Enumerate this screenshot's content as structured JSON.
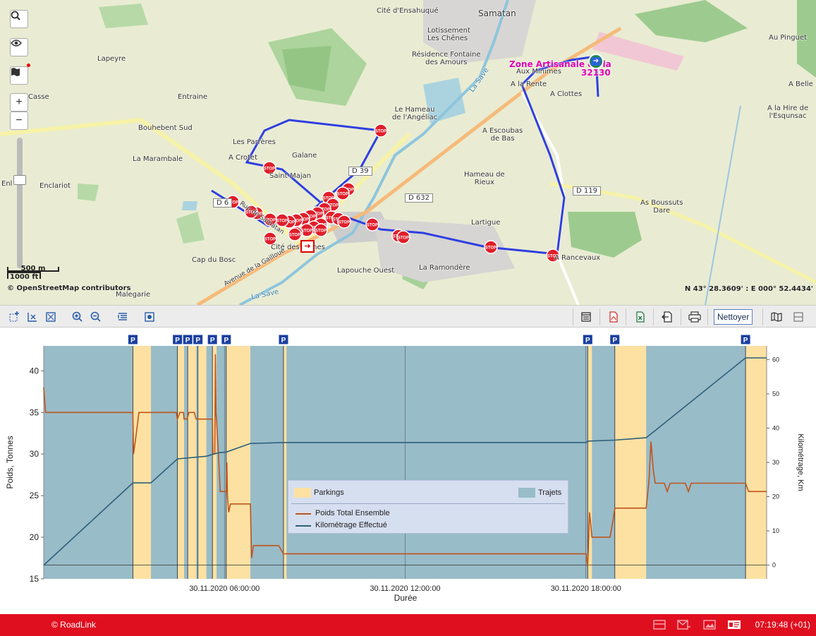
{
  "map": {
    "places": [
      {
        "name": "Samatan"
      },
      {
        "name": "Cité d'Ensahuqué"
      },
      {
        "name": "Lotissement\nLes Chênes"
      },
      {
        "name": "Résidence Fontaine\ndes Amours"
      },
      {
        "name": "Lapeyre"
      },
      {
        "name": "Entraine"
      },
      {
        "name": "Casse"
      },
      {
        "name": "Bouhebent Sud"
      },
      {
        "name": "La Marambale"
      },
      {
        "name": "Enclariot"
      },
      {
        "name": "Enl"
      },
      {
        "name": "Les Parrères"
      },
      {
        "name": "A Crotet"
      },
      {
        "name": "Galane"
      },
      {
        "name": "Saint-Majan"
      },
      {
        "name": "Le Hameau\nde l'Angéliac"
      },
      {
        "name": "Aux Minimes"
      },
      {
        "name": "A la Rente"
      },
      {
        "name": "A Clottes"
      },
      {
        "name": "A Escoubas\nde Bas"
      },
      {
        "name": "Hameau de\nRieux"
      },
      {
        "name": "Au Pinguet"
      },
      {
        "name": "A Belle"
      },
      {
        "name": "A la Hire de\nl'Esqunsac"
      },
      {
        "name": "As Boussuts\nDare"
      },
      {
        "name": "Lartigue"
      },
      {
        "name": "A Rancevaux"
      },
      {
        "name": "La Ramondère"
      },
      {
        "name": "Lapouche Ouest"
      },
      {
        "name": "Cité des Ormes"
      },
      {
        "name": "Cap du Bosc"
      },
      {
        "name": "Malegarie"
      },
      {
        "name": "La Save"
      },
      {
        "name": "La Save"
      },
      {
        "name": "Avenue de la Gailloue"
      },
      {
        "name": "Rue de Samatan"
      }
    ],
    "roads": [
      "D 39",
      "D 632",
      "D 119",
      "D 6"
    ],
    "zone": {
      "line1": "Zone Artisanale du la",
      "line2": "32130"
    },
    "scale": {
      "metric": "500 m",
      "imperial": "1000 ft"
    },
    "attribution": "© OpenStreetMap contributors",
    "coordinates": "N 43° 28.3609' : E 000° 52.4434'",
    "stop_label": "STOP",
    "controls": [
      "search-icon",
      "eye-icon",
      "map-icon",
      "zoom-in",
      "zoom-out"
    ],
    "zoom": {
      "in": "+",
      "out": "−"
    }
  },
  "toolbar": {
    "nettoyer": "Nettoyer"
  },
  "chart_data": {
    "type": "line",
    "xlabel": "Durée",
    "ylabel": "Poids, Tonnes",
    "y2label": "Kilométrage, Km",
    "ylim": [
      15,
      43
    ],
    "y2lim": [
      -4,
      64
    ],
    "yticks": [
      15,
      20,
      25,
      30,
      35,
      40
    ],
    "y2ticks": [
      0,
      10,
      20,
      30,
      40,
      50,
      60
    ],
    "xlim": [
      0,
      1.4
    ],
    "xticks": [
      {
        "x": 0.3,
        "label": "30.11.2020 06:00:00"
      },
      {
        "x": 0.6,
        "label": "30.11.2020 12:00:00"
      },
      {
        "x": 0.9,
        "label": "30.11.2020 18:00:00"
      }
    ],
    "parking_marker": "P",
    "parkings": [
      [
        0.148,
        0.178
      ],
      [
        0.222,
        0.233
      ],
      [
        0.239,
        0.253
      ],
      [
        0.256,
        0.27
      ],
      [
        0.28,
        0.287
      ],
      [
        0.303,
        0.343
      ],
      [
        0.398,
        0.403
      ],
      [
        0.903,
        0.91
      ],
      [
        0.948,
        1.0
      ],
      [
        1.165,
        1.2
      ]
    ],
    "legend": {
      "parkings": "Parkings",
      "trajets": "Trajets",
      "poids": "Poids Total Ensemble",
      "km": "Kilométrage Effectué"
    },
    "series": [
      {
        "name": "Poids Total Ensemble",
        "axis": "left",
        "color": "#c0541a",
        "points": [
          [
            0.0,
            38
          ],
          [
            0.003,
            35
          ],
          [
            0.148,
            35
          ],
          [
            0.149,
            30
          ],
          [
            0.152,
            31.5
          ],
          [
            0.158,
            35
          ],
          [
            0.16,
            35
          ],
          [
            0.165,
            35
          ],
          [
            0.178,
            35
          ],
          [
            0.2,
            35
          ],
          [
            0.22,
            35
          ],
          [
            0.222,
            34.2
          ],
          [
            0.226,
            35
          ],
          [
            0.232,
            35
          ],
          [
            0.233,
            34.2
          ],
          [
            0.238,
            34.2
          ],
          [
            0.241,
            35
          ],
          [
            0.25,
            35
          ],
          [
            0.253,
            34.2
          ],
          [
            0.27,
            34.2
          ],
          [
            0.28,
            34.2
          ],
          [
            0.281,
            30
          ],
          [
            0.284,
            30
          ],
          [
            0.285,
            42
          ],
          [
            0.286,
            35
          ],
          [
            0.287,
            34
          ],
          [
            0.29,
            30
          ],
          [
            0.293,
            25.5
          ],
          [
            0.303,
            25.5
          ],
          [
            0.304,
            29
          ],
          [
            0.305,
            25
          ],
          [
            0.307,
            23
          ],
          [
            0.31,
            24
          ],
          [
            0.315,
            24
          ],
          [
            0.343,
            24
          ],
          [
            0.345,
            17.5
          ],
          [
            0.348,
            19
          ],
          [
            0.35,
            19
          ],
          [
            0.39,
            19
          ],
          [
            0.398,
            18
          ],
          [
            0.403,
            18
          ],
          [
            0.9,
            18
          ],
          [
            0.903,
            16.5
          ],
          [
            0.906,
            23
          ],
          [
            0.91,
            20
          ],
          [
            0.915,
            20
          ],
          [
            0.94,
            20
          ],
          [
            0.945,
            22
          ],
          [
            0.948,
            23.5
          ],
          [
            0.955,
            23.5
          ],
          [
            1.0,
            23.5
          ],
          [
            1.005,
            27
          ],
          [
            1.008,
            31.5
          ],
          [
            1.012,
            28
          ],
          [
            1.015,
            26.5
          ],
          [
            1.03,
            26.5
          ],
          [
            1.035,
            25.5
          ],
          [
            1.04,
            26.5
          ],
          [
            1.065,
            26.5
          ],
          [
            1.07,
            25.5
          ],
          [
            1.075,
            26.5
          ],
          [
            1.1,
            26.5
          ],
          [
            1.165,
            26.5
          ],
          [
            1.17,
            25.5
          ],
          [
            1.2,
            25.5
          ]
        ]
      },
      {
        "name": "Kilométrage Effectué",
        "axis": "right",
        "color": "#2e5f7a",
        "points": [
          [
            0.0,
            0
          ],
          [
            0.148,
            24
          ],
          [
            0.178,
            24
          ],
          [
            0.222,
            31
          ],
          [
            0.253,
            31.5
          ],
          [
            0.27,
            31.8
          ],
          [
            0.29,
            32.8
          ],
          [
            0.303,
            33
          ],
          [
            0.343,
            35.5
          ],
          [
            0.398,
            35.8
          ],
          [
            0.9,
            35.8
          ],
          [
            0.903,
            36.2
          ],
          [
            0.948,
            36.5
          ],
          [
            1.0,
            37.2
          ],
          [
            1.02,
            40
          ],
          [
            1.165,
            60.5
          ],
          [
            1.2,
            60.5
          ]
        ]
      }
    ]
  },
  "footer": {
    "copyright": "© RoadLink",
    "time": "07:19:48 (+01)"
  }
}
